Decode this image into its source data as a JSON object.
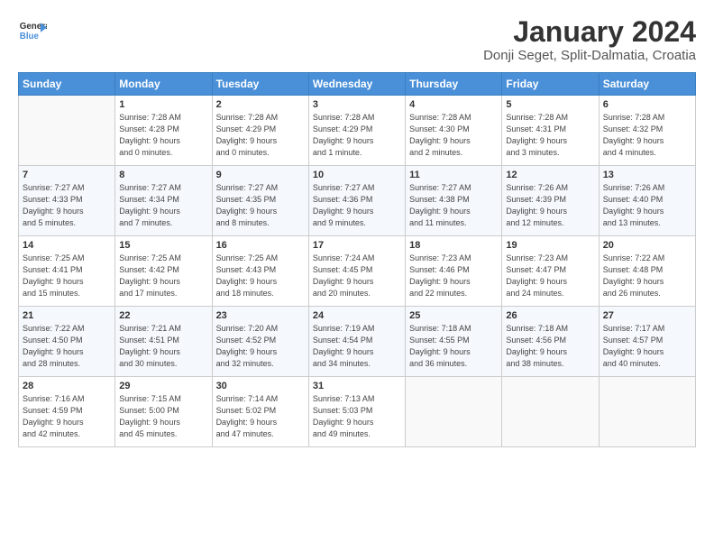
{
  "logo": {
    "line1": "General",
    "line2": "Blue"
  },
  "title": "January 2024",
  "location": "Donji Seget, Split-Dalmatia, Croatia",
  "days_header": [
    "Sunday",
    "Monday",
    "Tuesday",
    "Wednesday",
    "Thursday",
    "Friday",
    "Saturday"
  ],
  "weeks": [
    [
      {
        "day": "",
        "info": ""
      },
      {
        "day": "1",
        "info": "Sunrise: 7:28 AM\nSunset: 4:28 PM\nDaylight: 9 hours\nand 0 minutes."
      },
      {
        "day": "2",
        "info": "Sunrise: 7:28 AM\nSunset: 4:29 PM\nDaylight: 9 hours\nand 0 minutes."
      },
      {
        "day": "3",
        "info": "Sunrise: 7:28 AM\nSunset: 4:29 PM\nDaylight: 9 hours\nand 1 minute."
      },
      {
        "day": "4",
        "info": "Sunrise: 7:28 AM\nSunset: 4:30 PM\nDaylight: 9 hours\nand 2 minutes."
      },
      {
        "day": "5",
        "info": "Sunrise: 7:28 AM\nSunset: 4:31 PM\nDaylight: 9 hours\nand 3 minutes."
      },
      {
        "day": "6",
        "info": "Sunrise: 7:28 AM\nSunset: 4:32 PM\nDaylight: 9 hours\nand 4 minutes."
      }
    ],
    [
      {
        "day": "7",
        "info": "Sunrise: 7:27 AM\nSunset: 4:33 PM\nDaylight: 9 hours\nand 5 minutes."
      },
      {
        "day": "8",
        "info": "Sunrise: 7:27 AM\nSunset: 4:34 PM\nDaylight: 9 hours\nand 7 minutes."
      },
      {
        "day": "9",
        "info": "Sunrise: 7:27 AM\nSunset: 4:35 PM\nDaylight: 9 hours\nand 8 minutes."
      },
      {
        "day": "10",
        "info": "Sunrise: 7:27 AM\nSunset: 4:36 PM\nDaylight: 9 hours\nand 9 minutes."
      },
      {
        "day": "11",
        "info": "Sunrise: 7:27 AM\nSunset: 4:38 PM\nDaylight: 9 hours\nand 11 minutes."
      },
      {
        "day": "12",
        "info": "Sunrise: 7:26 AM\nSunset: 4:39 PM\nDaylight: 9 hours\nand 12 minutes."
      },
      {
        "day": "13",
        "info": "Sunrise: 7:26 AM\nSunset: 4:40 PM\nDaylight: 9 hours\nand 13 minutes."
      }
    ],
    [
      {
        "day": "14",
        "info": "Sunrise: 7:25 AM\nSunset: 4:41 PM\nDaylight: 9 hours\nand 15 minutes."
      },
      {
        "day": "15",
        "info": "Sunrise: 7:25 AM\nSunset: 4:42 PM\nDaylight: 9 hours\nand 17 minutes."
      },
      {
        "day": "16",
        "info": "Sunrise: 7:25 AM\nSunset: 4:43 PM\nDaylight: 9 hours\nand 18 minutes."
      },
      {
        "day": "17",
        "info": "Sunrise: 7:24 AM\nSunset: 4:45 PM\nDaylight: 9 hours\nand 20 minutes."
      },
      {
        "day": "18",
        "info": "Sunrise: 7:23 AM\nSunset: 4:46 PM\nDaylight: 9 hours\nand 22 minutes."
      },
      {
        "day": "19",
        "info": "Sunrise: 7:23 AM\nSunset: 4:47 PM\nDaylight: 9 hours\nand 24 minutes."
      },
      {
        "day": "20",
        "info": "Sunrise: 7:22 AM\nSunset: 4:48 PM\nDaylight: 9 hours\nand 26 minutes."
      }
    ],
    [
      {
        "day": "21",
        "info": "Sunrise: 7:22 AM\nSunset: 4:50 PM\nDaylight: 9 hours\nand 28 minutes."
      },
      {
        "day": "22",
        "info": "Sunrise: 7:21 AM\nSunset: 4:51 PM\nDaylight: 9 hours\nand 30 minutes."
      },
      {
        "day": "23",
        "info": "Sunrise: 7:20 AM\nSunset: 4:52 PM\nDaylight: 9 hours\nand 32 minutes."
      },
      {
        "day": "24",
        "info": "Sunrise: 7:19 AM\nSunset: 4:54 PM\nDaylight: 9 hours\nand 34 minutes."
      },
      {
        "day": "25",
        "info": "Sunrise: 7:18 AM\nSunset: 4:55 PM\nDaylight: 9 hours\nand 36 minutes."
      },
      {
        "day": "26",
        "info": "Sunrise: 7:18 AM\nSunset: 4:56 PM\nDaylight: 9 hours\nand 38 minutes."
      },
      {
        "day": "27",
        "info": "Sunrise: 7:17 AM\nSunset: 4:57 PM\nDaylight: 9 hours\nand 40 minutes."
      }
    ],
    [
      {
        "day": "28",
        "info": "Sunrise: 7:16 AM\nSunset: 4:59 PM\nDaylight: 9 hours\nand 42 minutes."
      },
      {
        "day": "29",
        "info": "Sunrise: 7:15 AM\nSunset: 5:00 PM\nDaylight: 9 hours\nand 45 minutes."
      },
      {
        "day": "30",
        "info": "Sunrise: 7:14 AM\nSunset: 5:02 PM\nDaylight: 9 hours\nand 47 minutes."
      },
      {
        "day": "31",
        "info": "Sunrise: 7:13 AM\nSunset: 5:03 PM\nDaylight: 9 hours\nand 49 minutes."
      },
      {
        "day": "",
        "info": ""
      },
      {
        "day": "",
        "info": ""
      },
      {
        "day": "",
        "info": ""
      }
    ]
  ]
}
